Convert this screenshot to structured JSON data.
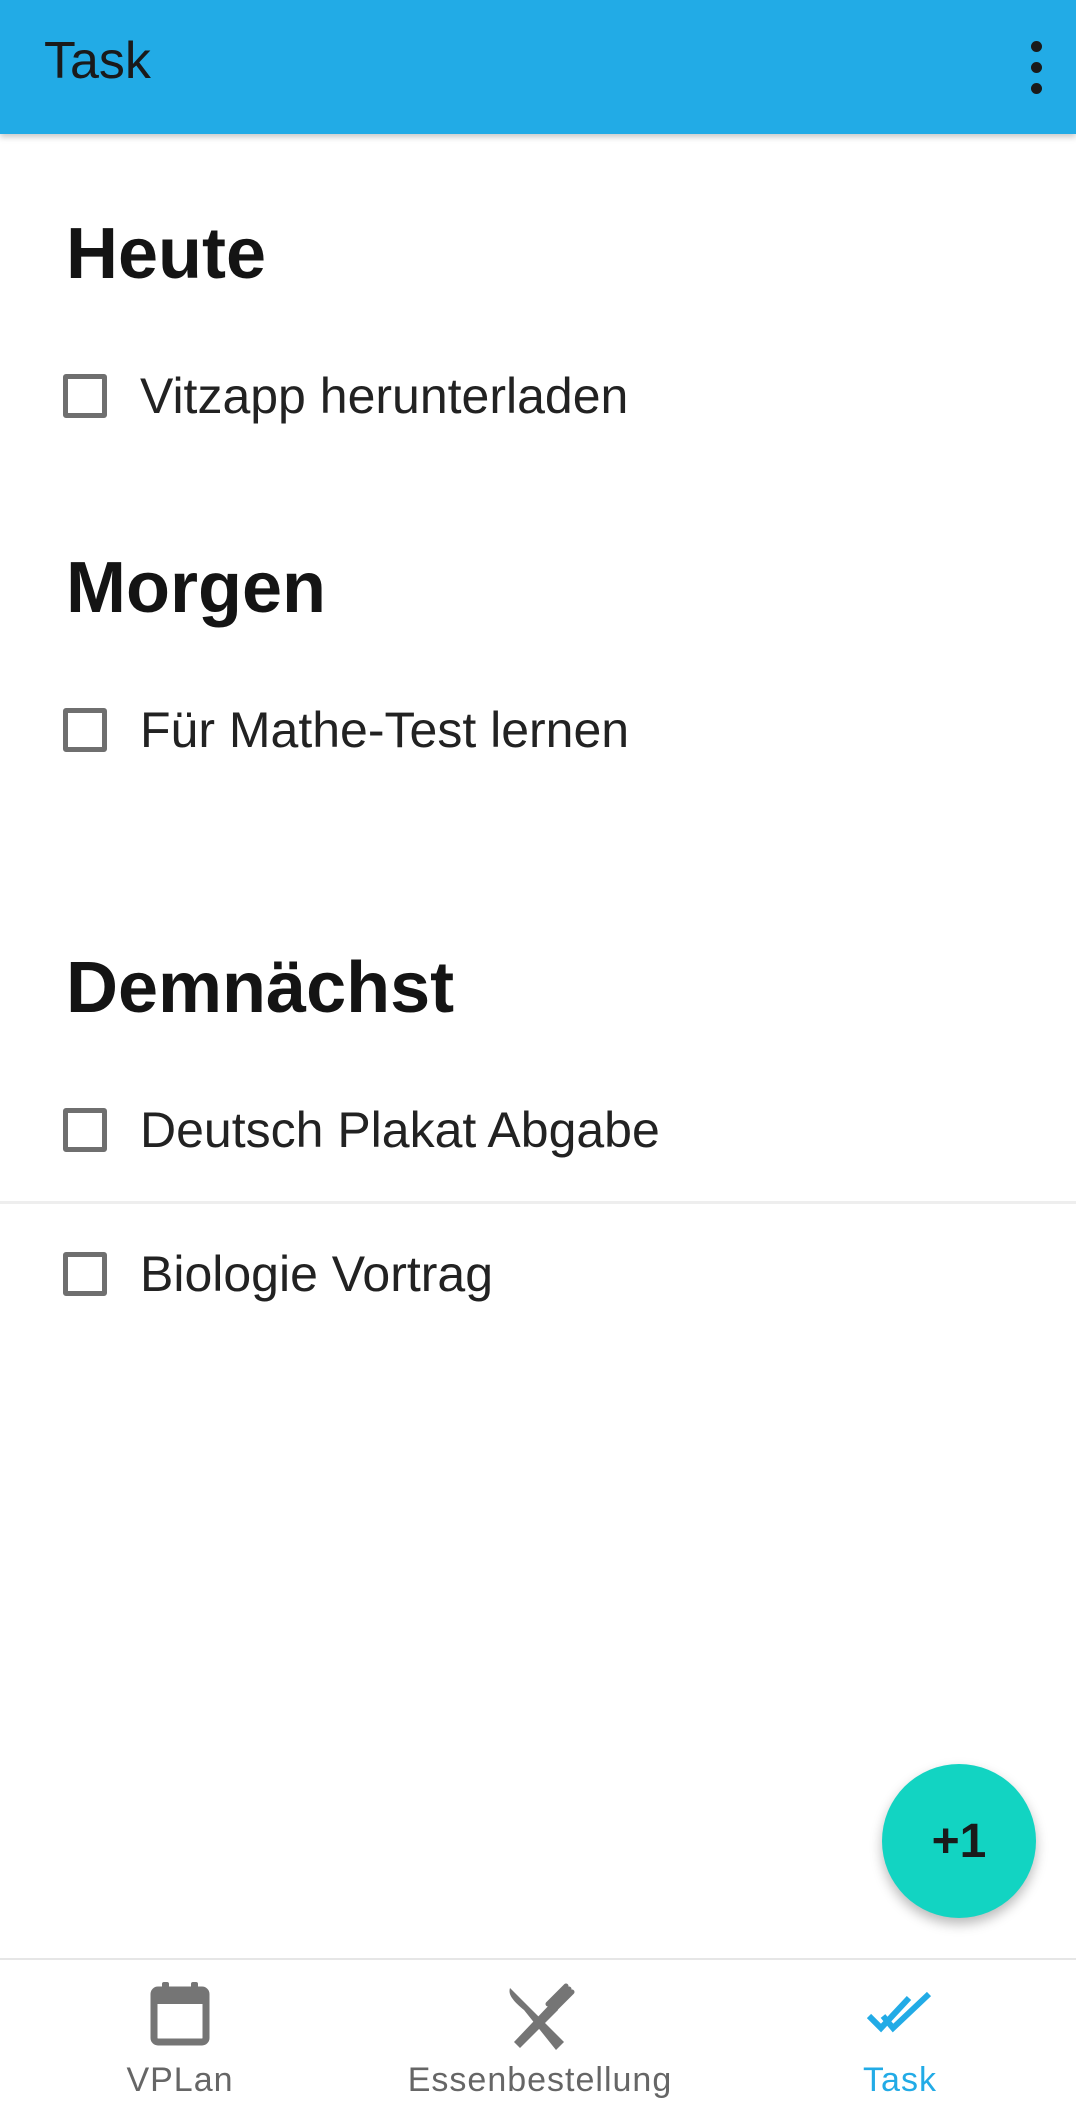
{
  "appbar": {
    "title": "Task",
    "menu_icon": "more-vert-icon"
  },
  "sections": [
    {
      "title": "Heute",
      "tasks": [
        {
          "label": "Vitzapp herunterladen",
          "checked": false
        }
      ]
    },
    {
      "title": "Morgen",
      "tasks": [
        {
          "label": "Für Mathe-Test lernen",
          "checked": false
        }
      ]
    },
    {
      "title": "Demnächst",
      "tasks": [
        {
          "label": "Deutsch Plakat Abgabe",
          "checked": false
        },
        {
          "label": "Biologie Vortrag",
          "checked": false
        }
      ]
    }
  ],
  "fab": {
    "label": "+1"
  },
  "bottom_nav": {
    "items": [
      {
        "label": "VPLan",
        "icon": "calendar-icon",
        "active": false
      },
      {
        "label": "Essenbestellung",
        "icon": "utensils-icon",
        "active": false
      },
      {
        "label": "Task",
        "icon": "done-all-icon",
        "active": true
      }
    ]
  },
  "colors": {
    "primary": "#22abe6",
    "fab": "#12d4c2",
    "inactive": "#666666"
  }
}
